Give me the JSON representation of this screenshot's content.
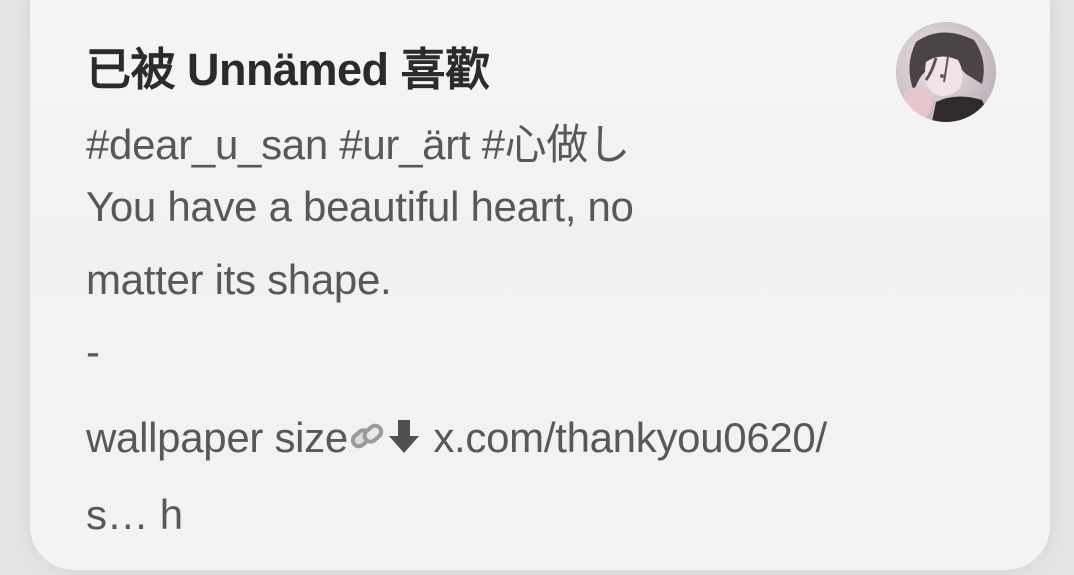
{
  "post": {
    "liked_by": "已被 Unnämed 喜歡",
    "hashtags": "#dear_u_san #ur_ärt #心做し",
    "body_line1": "You have a beautiful heart, no",
    "body_line2": "matter its shape.",
    "separator": "-",
    "link_prefix": "wallpaper size",
    "link_icons": [
      "link-icon",
      "down-arrow-icon"
    ],
    "link_text": "x.com/thankyou0620/",
    "link_continuation": "s… h"
  },
  "avatar": {
    "icon": "user-avatar"
  }
}
